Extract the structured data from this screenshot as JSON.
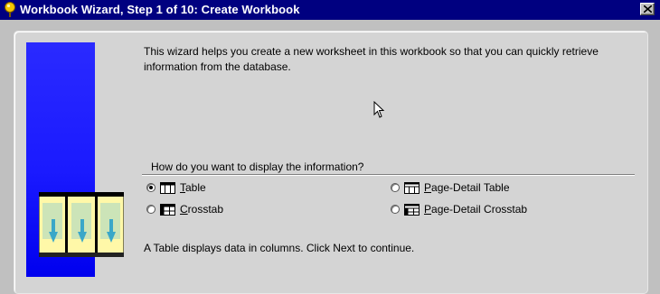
{
  "window": {
    "title": "Workbook Wizard, Step 1 of 10: Create Workbook"
  },
  "intro_text": "This wizard helps you create a new worksheet in this workbook so that you can quickly retrieve information from the database.",
  "display_group": {
    "label": "How do you want to display the information?",
    "options": [
      {
        "mnemonic": "T",
        "rest": "able",
        "label": "Table",
        "checked": true,
        "icon": "table-icon"
      },
      {
        "mnemonic": "C",
        "rest": "rosstab",
        "label": "Crosstab",
        "checked": false,
        "icon": "crosstab-icon"
      },
      {
        "mnemonic": "P",
        "rest": "age-Detail Table",
        "label": "Page-Detail Table",
        "checked": false,
        "icon": "page-detail-table-icon"
      },
      {
        "mnemonic": "P",
        "rest": "age-Detail Crosstab",
        "label": "Page-Detail Crosstab",
        "checked": false,
        "icon": "page-detail-crosstab-icon"
      }
    ]
  },
  "footer_text": "A Table displays data in columns. Click Next to continue.",
  "colors": {
    "titlebar": "#000080",
    "banner": "#1a1aff",
    "panel": "#d4d4d4"
  }
}
